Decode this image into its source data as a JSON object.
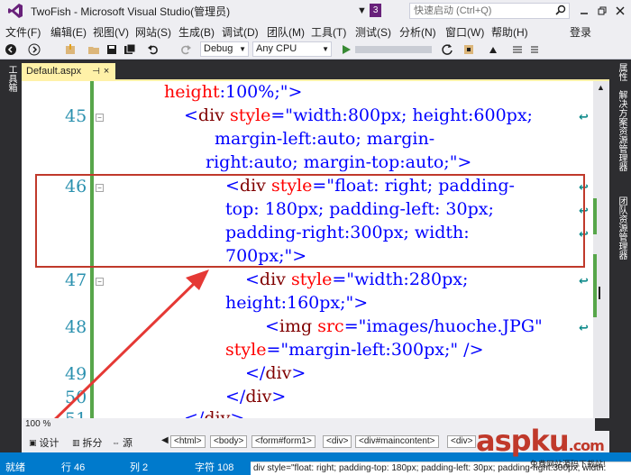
{
  "window": {
    "title": "TwoFish - Microsoft Visual Studio(管理员)",
    "notification_count": "3",
    "quick_launch_placeholder": "快速启动 (Ctrl+Q)",
    "icons": [
      "vs-logo-icon",
      "filter-icon",
      "search-icon",
      "minimize-icon",
      "restore-icon",
      "close-icon"
    ]
  },
  "menu": {
    "items": [
      "文件(F)",
      "编辑(E)",
      "视图(V)",
      "网站(S)",
      "生成(B)",
      "调试(D)",
      "团队(M)",
      "工具(T)",
      "测试(S)",
      "分析(N)",
      "窗口(W)",
      "帮助(H)"
    ],
    "login": "登录"
  },
  "toolbar": {
    "configuration": "Debug",
    "platform": "Any CPU"
  },
  "left_panel": {
    "label": "工具箱"
  },
  "right_panel": {
    "labels": [
      "属性",
      "解决方案资源管理器",
      "团队资源管理器"
    ]
  },
  "document_tab": {
    "label": "Default.aspx"
  },
  "code": {
    "lines": [
      {
        "num": "",
        "segments": [
          [
            "attr",
            "height"
          ],
          [
            "punc",
            ":"
          ],
          [
            "str",
            "100%"
          ],
          [
            "punc",
            ";\">"
          ]
        ]
      },
      {
        "num": "45",
        "segments": [
          [
            "punc",
            "<"
          ],
          [
            "kw",
            "div "
          ],
          [
            "attr",
            "style"
          ],
          [
            "punc",
            "=\""
          ],
          [
            "str",
            "width:800px; height:600px;"
          ]
        ]
      },
      {
        "num": "",
        "segments": [
          [
            "str",
            "margin-left:auto; margin-"
          ]
        ]
      },
      {
        "num": "",
        "segments": [
          [
            "str",
            "right:auto; margin-top:auto;"
          ],
          [
            "punc",
            "\">"
          ]
        ]
      },
      {
        "num": "46",
        "segments": [
          [
            "punc",
            "<"
          ],
          [
            "kw",
            "div "
          ],
          [
            "attr",
            "style"
          ],
          [
            "punc",
            "=\""
          ],
          [
            "str",
            "float: right; padding-"
          ]
        ]
      },
      {
        "num": "",
        "segments": [
          [
            "str",
            "top: 180px; padding-left: 30px;"
          ]
        ]
      },
      {
        "num": "",
        "segments": [
          [
            "str",
            "padding-right:300px; width:"
          ]
        ]
      },
      {
        "num": "",
        "segments": [
          [
            "str",
            "700px;"
          ],
          [
            "punc",
            "\">"
          ]
        ]
      },
      {
        "num": "47",
        "segments": [
          [
            "punc",
            "<"
          ],
          [
            "kw",
            "div "
          ],
          [
            "attr",
            "style"
          ],
          [
            "punc",
            "=\""
          ],
          [
            "str",
            "width:280px;"
          ]
        ]
      },
      {
        "num": "",
        "segments": [
          [
            "str",
            "height:160px;"
          ],
          [
            "punc",
            "\">"
          ]
        ]
      },
      {
        "num": "48",
        "segments": [
          [
            "punc",
            "<"
          ],
          [
            "kw",
            "img "
          ],
          [
            "attr",
            "src"
          ],
          [
            "punc",
            "=\""
          ],
          [
            "str",
            "images/huoche.JPG"
          ],
          [
            "punc",
            "\""
          ]
        ]
      },
      {
        "num": "",
        "segments": [
          [
            "attr",
            "style"
          ],
          [
            "punc",
            "=\""
          ],
          [
            "str",
            "margin-left:300px;"
          ],
          [
            "punc",
            "\" />"
          ]
        ]
      },
      {
        "num": "49",
        "segments": [
          [
            "punc",
            "</"
          ],
          [
            "kw",
            "div"
          ],
          [
            "punc",
            ">"
          ]
        ]
      },
      {
        "num": "50",
        "segments": [
          [
            "punc",
            "</"
          ],
          [
            "kw",
            "div"
          ],
          [
            "punc",
            ">"
          ]
        ]
      },
      {
        "num": "51",
        "segments": [
          [
            "punc",
            "</"
          ],
          [
            "kw",
            "div"
          ],
          [
            "punc",
            ">"
          ]
        ]
      }
    ]
  },
  "zoom": "100 %",
  "view_modes": [
    "设计",
    "拆分",
    "源"
  ],
  "breadcrumbs": [
    "<html>",
    "<body>",
    "<form#form1>",
    "<div>",
    "<div#maincontent>",
    "<div>"
  ],
  "status": {
    "ready": "就绪",
    "line": "行 46",
    "col": "列 2",
    "char": "字符 108",
    "tooltip": "div style=\"float: right; padding-top: 180px; padding-left: 30px; padding-right:300px; width:"
  },
  "watermark": {
    "brand": "aspku",
    "tld": ".com",
    "sub": "免费网站源码下载站!"
  }
}
